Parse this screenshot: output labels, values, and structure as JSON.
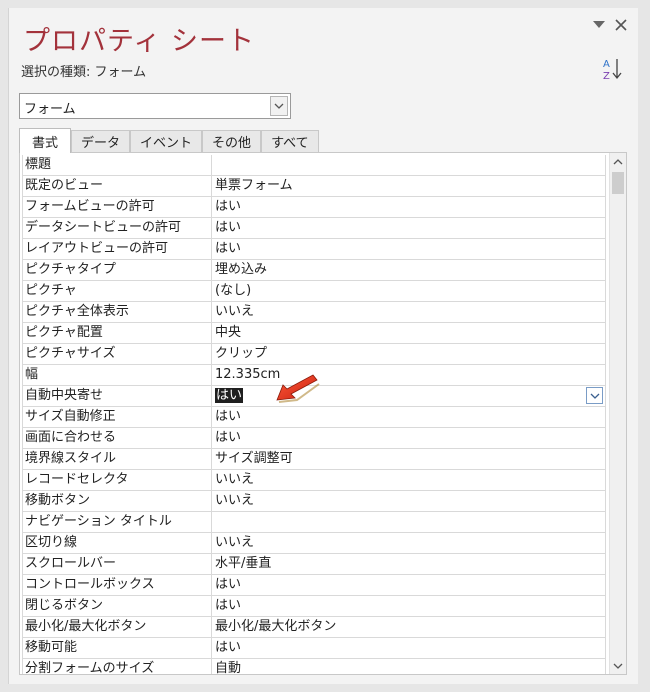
{
  "window": {
    "title": "プロパティ シート",
    "dropdown_icon": "triangle-down-icon",
    "close_icon": "close-icon"
  },
  "selection_type": "選択の種類:  フォーム",
  "sort_icon": "sort-az-icon",
  "object_combo": {
    "value": "フォーム"
  },
  "tabs": [
    {
      "label": "書式",
      "active": true
    },
    {
      "label": "データ",
      "active": false
    },
    {
      "label": "イベント",
      "active": false
    },
    {
      "label": "その他",
      "active": false
    },
    {
      "label": "すべて",
      "active": false
    }
  ],
  "properties": [
    {
      "name": "標題",
      "value": ""
    },
    {
      "name": "既定のビュー",
      "value": "単票フォーム"
    },
    {
      "name": "フォームビューの許可",
      "value": "はい"
    },
    {
      "name": "データシートビューの許可",
      "value": "はい"
    },
    {
      "name": "レイアウトビューの許可",
      "value": "はい"
    },
    {
      "name": "ピクチャタイプ",
      "value": "埋め込み"
    },
    {
      "name": "ピクチャ",
      "value": "(なし)"
    },
    {
      "name": "ピクチャ全体表示",
      "value": "いいえ"
    },
    {
      "name": "ピクチャ配置",
      "value": "中央"
    },
    {
      "name": "ピクチャサイズ",
      "value": "クリップ"
    },
    {
      "name": "幅",
      "value": "12.335cm"
    },
    {
      "name": "自動中央寄せ",
      "value": "はい",
      "selected": true
    },
    {
      "name": "サイズ自動修正",
      "value": "はい"
    },
    {
      "name": "画面に合わせる",
      "value": "はい"
    },
    {
      "name": "境界線スタイル",
      "value": "サイズ調整可"
    },
    {
      "name": "レコードセレクタ",
      "value": "いいえ"
    },
    {
      "name": "移動ボタン",
      "value": "いいえ"
    },
    {
      "name": "ナビゲーション タイトル",
      "value": ""
    },
    {
      "name": "区切り線",
      "value": "いいえ"
    },
    {
      "name": "スクロールバー",
      "value": "水平/垂直"
    },
    {
      "name": "コントロールボックス",
      "value": "はい"
    },
    {
      "name": "閉じるボタン",
      "value": "はい"
    },
    {
      "name": "最小化/最大化ボタン",
      "value": "最小化/最大化ボタン"
    },
    {
      "name": "移動可能",
      "value": "はい"
    },
    {
      "name": "分割フォームのサイズ",
      "value": "自動"
    }
  ],
  "colors": {
    "title": "#a3323b",
    "pointer_arrow": "#e0321e"
  }
}
